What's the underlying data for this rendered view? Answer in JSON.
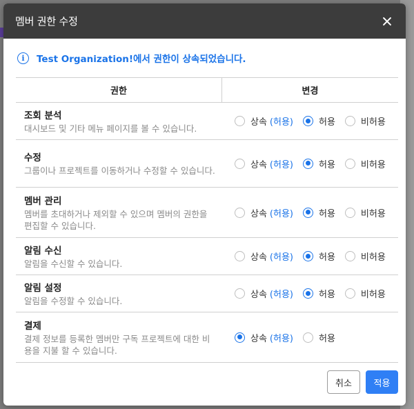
{
  "dialog": {
    "title": "멤버 권한 수정",
    "notice": "Test Organization!에서 권한이 상속되었습니다."
  },
  "table": {
    "headers": {
      "permission": "권한",
      "change": "변경"
    },
    "rows": [
      {
        "title": "조회 분석",
        "desc": "대시보드 및 기타 메뉴 페이지를 볼 수 있습니다.",
        "inherit_label": "상속",
        "inherit_value": "(허용)",
        "allow": "허용",
        "deny": "비허용",
        "selected": "allow"
      },
      {
        "title": "수정",
        "desc": "그룹이나 프로젝트를 이동하거나 수정할 수 있습니다.",
        "inherit_label": "상속",
        "inherit_value": "(허용)",
        "allow": "허용",
        "deny": "비허용",
        "selected": "allow"
      },
      {
        "title": "멤버 관리",
        "desc": "멤버를 초대하거나 제외할 수 있으며 멤버의 권한을 편집할 수 있습니다.",
        "inherit_label": "상속",
        "inherit_value": "(허용)",
        "allow": "허용",
        "deny": "비허용",
        "selected": "allow"
      },
      {
        "title": "알림 수신",
        "desc": "알림을 수신할 수 있습니다.",
        "inherit_label": "상속",
        "inherit_value": "(허용)",
        "allow": "허용",
        "deny": "비허용",
        "selected": "allow"
      },
      {
        "title": "알림 설정",
        "desc": "알림을 수정할 수 있습니다.",
        "inherit_label": "상속",
        "inherit_value": "(허용)",
        "allow": "허용",
        "deny": "비허용",
        "selected": "allow"
      },
      {
        "title": "결제",
        "desc": "결제 정보를 등록한 멤버만 구독 프로젝트에 대한 비용을 지불 할 수 있습니다.",
        "inherit_label": "상속",
        "inherit_value": "(허용)",
        "allow": "허용",
        "selected": "inherit"
      }
    ]
  },
  "footer": {
    "cancel_label": "취소",
    "apply_label": "적용"
  },
  "icons": {
    "close": "close-icon",
    "info": "info-icon"
  },
  "colors": {
    "accent": "#1a73e8",
    "header_bg": "#3c3c3c",
    "apply_bg": "#2f7ff5"
  }
}
